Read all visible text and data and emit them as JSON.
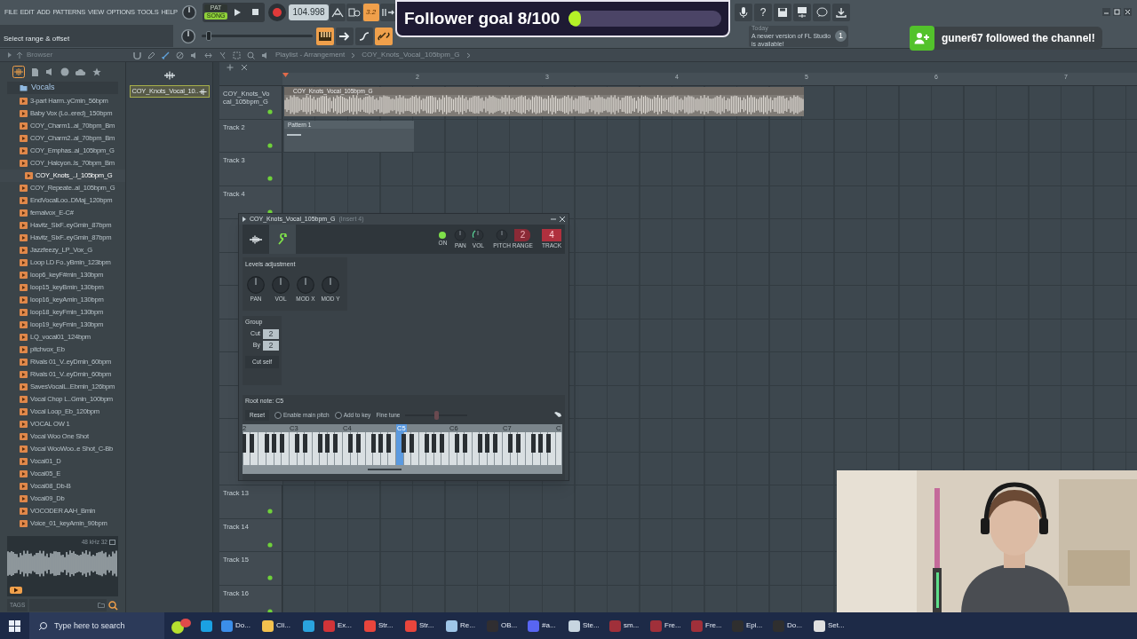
{
  "menu": [
    "FILE",
    "EDIT",
    "ADD",
    "PATTERNS",
    "VIEW",
    "OPTIONS",
    "TOOLS",
    "HELP"
  ],
  "mode": [
    {
      "label": "PAT",
      "selected": false
    },
    {
      "label": "SONG",
      "selected": true
    }
  ],
  "tempo": "104.998",
  "toggles_top": [
    {
      "kind": "tilt",
      "on": false
    },
    {
      "kind": "wait",
      "on": false
    },
    {
      "kind": "countdown",
      "label": "3.2",
      "on": true
    },
    {
      "kind": "step",
      "on": false
    }
  ],
  "toggles_bottom": [
    {
      "kind": "keys",
      "on": true
    },
    {
      "kind": "arrow",
      "on": false
    },
    {
      "kind": "curve",
      "on": false
    },
    {
      "kind": "link",
      "on": true
    }
  ],
  "hint": "Select range & offset",
  "master_pitch": {
    "level": 0.04
  },
  "help_label": "?",
  "news": {
    "date": "Today",
    "message": "A newer version of FL Studio is available!",
    "count": "1"
  },
  "follower_goal": {
    "label": "Follower goal 8/100",
    "level": 0.08
  },
  "notification": "guner67 followed the channel!",
  "browser": {
    "title": "Browser",
    "folder": "Vocals",
    "items": [
      {
        "label": "3-part Harm..yCmin_56bpm",
        "selected": false
      },
      {
        "label": "Baby Vox (Lo..ered)_150bpm",
        "selected": false
      },
      {
        "label": "COY_Charm1..al_70bpm_Bm",
        "selected": false
      },
      {
        "label": "COY_Charm2..al_70bpm_Bm",
        "selected": false
      },
      {
        "label": "COY_Emphas..al_105bpm_G",
        "selected": false
      },
      {
        "label": "COY_Halcyon..ls_70bpm_Bm",
        "selected": false
      },
      {
        "label": "COY_Knots_..l_105bpm_G",
        "selected": true
      },
      {
        "label": "COY_Repeate..al_105bpm_G",
        "selected": false
      },
      {
        "label": "EndVocalLoo..DMaj_120bpm",
        "selected": false
      },
      {
        "label": "femalvox_E-C#",
        "selected": false
      },
      {
        "label": "Havitz_SixF..eyGmin_87bpm",
        "selected": false
      },
      {
        "label": "Havitz_SixF..eyGmin_87bpm",
        "selected": false
      },
      {
        "label": "Jazzfeezy_LP_Vox_G",
        "selected": false
      },
      {
        "label": "Loop LD Fo..yBmin_123bpm",
        "selected": false
      },
      {
        "label": "loop6_keyF#min_130bpm",
        "selected": false
      },
      {
        "label": "loop15_keyBmin_130bpm",
        "selected": false
      },
      {
        "label": "loop16_keyAmin_130bpm",
        "selected": false
      },
      {
        "label": "loop18_keyFmin_130bpm",
        "selected": false
      },
      {
        "label": "loop19_keyFmin_130bpm",
        "selected": false
      },
      {
        "label": "LQ_vocal01_124bpm",
        "selected": false
      },
      {
        "label": "pitchvox_Eb",
        "selected": false
      },
      {
        "label": "Rivals 01_V..eyDmin_60bpm",
        "selected": false
      },
      {
        "label": "Rivals 01_V..eyDmin_60bpm",
        "selected": false
      },
      {
        "label": "SavesVocalL..Ebmin_126bpm",
        "selected": false
      },
      {
        "label": "Vocal Chop L..Gmin_100bpm",
        "selected": false
      },
      {
        "label": "Vocal Loop_Eb_120bpm",
        "selected": false
      },
      {
        "label": "VOCAL OW 1",
        "selected": false
      },
      {
        "label": "Vocal Woo One Shot",
        "selected": false
      },
      {
        "label": "Vocal WooWoo..e Shot_C-Bb",
        "selected": false
      },
      {
        "label": "Vocal01_D",
        "selected": false
      },
      {
        "label": "Vocal05_E",
        "selected": false
      },
      {
        "label": "Vocal08_Db-B",
        "selected": false
      },
      {
        "label": "Vocal09_Db",
        "selected": false
      },
      {
        "label": "VOCODER AAH_Bmin",
        "selected": false
      },
      {
        "label": "Voice_01_keyAmin_90bpm",
        "selected": false
      }
    ],
    "preview_info": "48 kHz 32",
    "tags_label": "TAGS"
  },
  "channel": {
    "name": "COY_Knots_Vocal_10..",
    "selected": true
  },
  "playlist": {
    "breadcrumb": [
      "Playlist - Arrangement",
      "COY_Knots_Vocal_105bpm_G"
    ],
    "bars": [
      "2",
      "3",
      "4",
      "5",
      "6",
      "7"
    ],
    "tracks_top": [
      {
        "label": "COY_Knots_Vocal_105bpm_G",
        "clip": {
          "kind": "audio",
          "label": "COY_Knots_Vocal_105bpm_G"
        }
      },
      {
        "label": "Track 2",
        "clip": {
          "kind": "pattern",
          "label": "Pattern 1"
        }
      },
      {
        "label": "Track 3"
      },
      {
        "label": "Track 4"
      }
    ],
    "tracks_bottom": [
      {
        "label": "Track 13"
      },
      {
        "label": "Track 14"
      },
      {
        "label": "Track 15"
      },
      {
        "label": "Track 16"
      }
    ]
  },
  "channel_settings": {
    "title": "COY_Knots_Vocal_105bpm_G",
    "insert": "(Insert 4)",
    "tabs": [
      {
        "kind": "wave",
        "selected": false
      },
      {
        "kind": "wrench",
        "selected": true
      }
    ],
    "on": true,
    "on_label": "ON",
    "pan_label": "PAN",
    "vol_label": "VOL",
    "pitch_label": "PITCH",
    "range_label": "RANGE",
    "range": "2",
    "track_label": "TRACK",
    "track": "4",
    "levels_title": "Levels adjustment",
    "knobs": [
      "PAN",
      "VOL",
      "MOD X",
      "MOD Y"
    ],
    "group": {
      "title": "Group",
      "cut_label": "Cut",
      "cut": "2",
      "by_label": "By",
      "by": "2",
      "cut_self": "Cut self"
    },
    "root_note": "Root note: C5",
    "reset": "Reset",
    "options": [
      {
        "label": "Enable main pitch",
        "checked": false
      },
      {
        "label": "Add to key",
        "checked": false
      }
    ],
    "fine_tune": {
      "label": "Fine tune",
      "level": 0.5
    },
    "octaves": [
      {
        "label": "2",
        "selected": false
      },
      {
        "label": "C3",
        "selected": false
      },
      {
        "label": "C4",
        "selected": false
      },
      {
        "label": "C5",
        "selected": true
      },
      {
        "label": "C6",
        "selected": false
      },
      {
        "label": "C7",
        "selected": false
      },
      {
        "label": "C",
        "selected": false
      }
    ]
  },
  "taskbar": {
    "placeholder": "Type here to search",
    "apps": [
      {
        "color": "#1ba1e2"
      },
      {
        "label": "Do...",
        "color": "#3b8eea"
      },
      {
        "label": "Cli...",
        "color": "#f2c14e"
      },
      {
        "color": "#2aa3de"
      },
      {
        "label": "Ex...",
        "color": "#d13438"
      },
      {
        "label": "Str...",
        "color": "#e8453c"
      },
      {
        "label": "Str...",
        "color": "#e8453c"
      },
      {
        "label": "Re...",
        "color": "#9fc6e8"
      },
      {
        "label": "OB...",
        "color": "#302e31"
      },
      {
        "label": "#a...",
        "color": "#5865f2"
      },
      {
        "label": "Ste...",
        "color": "#c7d5e0"
      },
      {
        "label": "sm...",
        "color": "#a0303a"
      },
      {
        "label": "Fre...",
        "color": "#a0303a"
      },
      {
        "label": "Fre...",
        "color": "#a0303a"
      },
      {
        "label": "Epi...",
        "color": "#2f2f2f"
      },
      {
        "label": "Do...",
        "color": "#2f2f2f"
      },
      {
        "label": "Set...",
        "color": "#e0e0e0"
      }
    ]
  }
}
